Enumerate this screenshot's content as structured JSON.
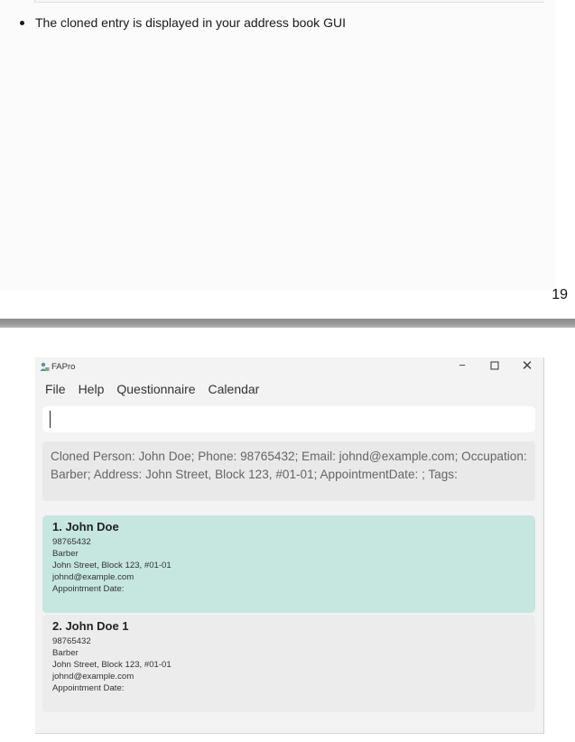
{
  "document": {
    "bullet_text": "The cloned entry is displayed in your address book GUI",
    "page_number": "19"
  },
  "app": {
    "title": "FAPro",
    "window_controls": {
      "minimize": "−",
      "maximize": "☐",
      "close": "✕"
    },
    "menu": [
      "File",
      "Help",
      "Questionnaire",
      "Calendar"
    ],
    "command_input": {
      "value": "",
      "placeholder": ""
    },
    "result_text": "Cloned Person: John Doe; Phone: 98765432; Email: johnd@example.com; Occupation: Barber; Address: John Street, Block 123, #01-01; AppointmentDate: ; Tags:",
    "persons": [
      {
        "name": "1.  John Doe",
        "phone": "98765432",
        "occupation": "Barber",
        "address": "John Street, Block 123, #01-01",
        "email": "johnd@example.com",
        "appointment": "Appointment Date:",
        "selected": true
      },
      {
        "name": "2.  John Doe 1",
        "phone": "98765432",
        "occupation": "Barber",
        "address": "John Street, Block 123, #01-01",
        "email": "johnd@example.com",
        "appointment": "Appointment Date:",
        "selected": false
      }
    ]
  },
  "colors": {
    "selected_card": "#c6e6e0",
    "plain_card": "#ececec",
    "result_box": "#e9e9e9",
    "window_bg": "#f3f3f3"
  }
}
